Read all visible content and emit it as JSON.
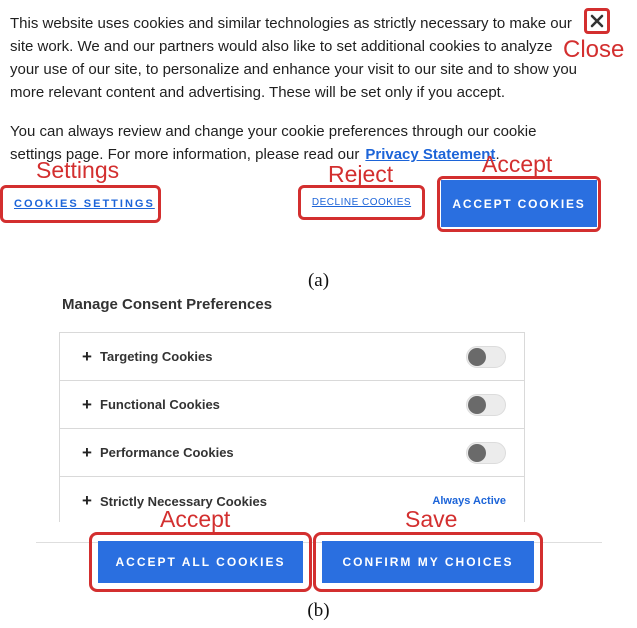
{
  "panel_a": {
    "paragraph1": "This website uses cookies and similar technologies as strictly necessary to make our site work. We and our partners would also like to set additional cookies to analyze your use of our site, to personalize and enhance your visit to our site and to show you more relevant content and advertising. These will be set only if you accept.",
    "paragraph2": "You can always review and change your cookie preferences through our cookie settings page. For more information, please read our",
    "privacy_link": "Privacy Statement",
    "privacy_suffix": ".",
    "settings_button": "COOKIES SETTINGS",
    "decline_button": "DECLINE COOKIES",
    "accept_button": "ACCEPT COOKIES",
    "annotations": {
      "close": "Close",
      "settings": "Settings",
      "reject": "Reject",
      "accept": "Accept"
    },
    "caption": "(a)"
  },
  "panel_b": {
    "title": "Manage Consent Preferences",
    "items": [
      {
        "label": "Targeting Cookies"
      },
      {
        "label": "Functional Cookies"
      },
      {
        "label": "Performance Cookies"
      },
      {
        "label": "Strictly Necessary Cookies",
        "status": "Always Active"
      }
    ],
    "accept_all_button": "ACCEPT ALL COOKIES",
    "confirm_button": "CONFIRM MY CHOICES",
    "annotations": {
      "accept": "Accept",
      "save": "Save"
    },
    "caption": "(b)"
  },
  "colors": {
    "accent_blue": "#2a6fe0",
    "link_blue": "#1c64d8",
    "annotation_red": "#d32f2f"
  }
}
